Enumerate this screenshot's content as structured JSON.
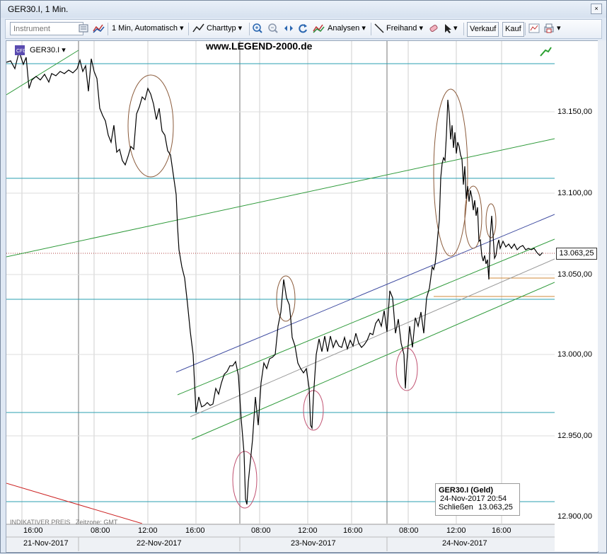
{
  "window": {
    "title": "GER30.I, 1 Min.",
    "close_glyph": "×"
  },
  "toolbar": {
    "instrument_placeholder": "Instrument",
    "interval": "1 Min,  Automatisch",
    "charttype": "Charttyp",
    "analysen": "Analysen",
    "freihand": "Freihand",
    "verkauf": "Verkauf",
    "kauf": "Kauf"
  },
  "chart": {
    "symbol": "GER30.I",
    "watermark": "www.LEGEND-2000.de",
    "current_price": "13.063,25",
    "indicative": "INDIKATIVER PREIS",
    "timezone": "Zeitzone: GMT",
    "price_labels": [
      "13.150,00",
      "13.100,00",
      "13.050,00",
      "13.000,00",
      "12.950,00",
      "12.900,00"
    ],
    "time_ticks": [
      "16:00",
      "08:00",
      "12:00",
      "16:00",
      "08:00",
      "12:00",
      "16:00",
      "08:00",
      "12:00",
      "16:00"
    ],
    "dates": [
      "21-Nov-2017",
      "22-Nov-2017",
      "23-Nov-2017",
      "24-Nov-2017"
    ],
    "info": {
      "title": "GER30.I (Geld)",
      "datetime": "24-Nov-2017 20:54",
      "close_label": "Schließen",
      "close_value": "13.063,25"
    }
  },
  "colors": {
    "price_line": "#000000",
    "hline": "#2a9fb0",
    "green_line": "#2e9a3a",
    "blue_line": "#3d4aa0",
    "red_line": "#cc2222",
    "orange_line": "#d08a3a"
  }
}
